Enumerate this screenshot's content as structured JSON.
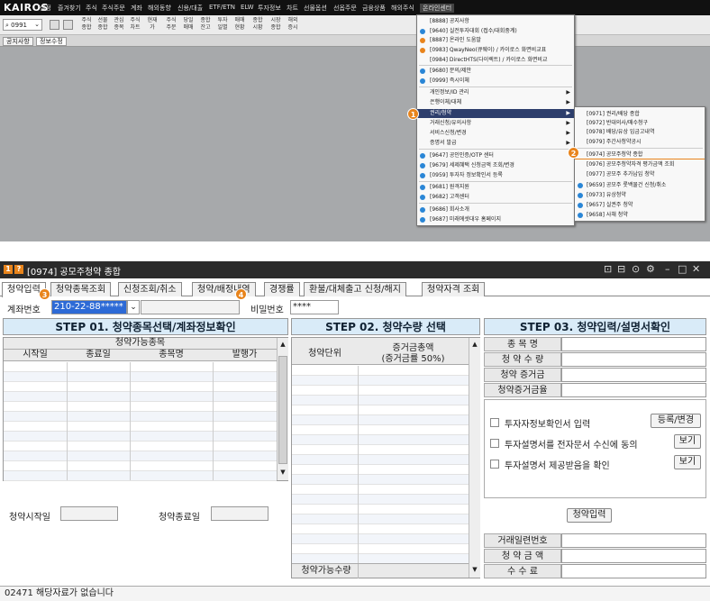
{
  "app": {
    "logo": "KAIROS",
    "menu": [
      "설정",
      "즐겨찾기",
      "주식",
      "주식주문",
      "계좌",
      "해외동향",
      "신용/대출",
      "ETF/ETN",
      "ELW",
      "투자정보",
      "차트",
      "선물옵션",
      "선옵주문",
      "금융상품",
      "해외주식",
      "온라인센터"
    ],
    "code_value": "0991",
    "toolbar_buttons": [
      "주식\n종합",
      "선물\n종합",
      "관심\n종목",
      "주식\n차트",
      "현재\n가",
      "주식\n주문",
      "당일\n매매",
      "종합\n잔고",
      "투자\n일별",
      "매매\n현황",
      "종합\n시황",
      "시장\n종합",
      "해외\n증시"
    ],
    "tabs": [
      "공지사항",
      "정보수정"
    ]
  },
  "dropdown": {
    "items": [
      {
        "label": "[8888] 공지사항",
        "icon": ""
      },
      {
        "label": "[9640] 실전투자대회 (접수/대회중계)",
        "icon": "blue"
      },
      {
        "label": "[8887] 온라인 도움말",
        "icon": "orange"
      },
      {
        "label": "[0983] QwayNeo(큐웨이) / 카이로스 화면비교표",
        "icon": "orange"
      },
      {
        "label": "[0984] DirectHTS(다이렉트) / 카이로스 화면비교",
        "icon": ""
      },
      {
        "label": "[9680] 문의/제안",
        "icon": "blue"
      },
      {
        "label": "[0999] 즉시이체",
        "icon": "blue"
      },
      {
        "label": "개인정보/ID 관리",
        "icon": "",
        "arrow": true
      },
      {
        "label": "은행이체/대체",
        "icon": "",
        "arrow": true
      },
      {
        "label": "권리/청약",
        "icon": "",
        "arrow": true,
        "hl": true
      },
      {
        "label": "거래신청/유의사항",
        "icon": "",
        "arrow": true
      },
      {
        "label": "서비스신청/변경",
        "icon": "",
        "arrow": true
      },
      {
        "label": "증명서 발급",
        "icon": "",
        "arrow": true
      },
      {
        "label": "[9647] 공인인증/OTP 센터",
        "icon": "blue"
      },
      {
        "label": "[9679] 세제혜택 신청금액 조회/변경",
        "icon": "blue"
      },
      {
        "label": "[0959] 투자자 정보확인서 등록",
        "icon": "blue"
      },
      {
        "label": "[9681] 원격지원",
        "icon": "blue"
      },
      {
        "label": "[9682] 고객센터",
        "icon": "blue"
      },
      {
        "label": "[9686] 회사소개",
        "icon": "blue"
      },
      {
        "label": "[9687] 미래에셋대우 홈페이지",
        "icon": "blue"
      }
    ],
    "submenu": [
      {
        "label": "[0971] 권리/배당 종합",
        "icon": ""
      },
      {
        "label": "[0972] 반대의사/매수청구",
        "icon": ""
      },
      {
        "label": "[0978] 배당/유상 입금고내역",
        "icon": ""
      },
      {
        "label": "[0979] 주간사청약공시",
        "icon": ""
      },
      {
        "label": "[0974] 공모주청약 종합",
        "icon": ""
      },
      {
        "label": "[0976] 공모주청약자격 평가금액 조회",
        "icon": ""
      },
      {
        "label": "[0977] 공모주 추가납입 청약",
        "icon": ""
      },
      {
        "label": "[9659] 공모주 롯백물건 신청/취소",
        "icon": "blue"
      },
      {
        "label": "[0973] 유상청약",
        "icon": "blue"
      },
      {
        "label": "[9657] 실권주 청약",
        "icon": "blue"
      },
      {
        "label": "[9658] 사채 청약",
        "icon": "blue"
      }
    ],
    "badges": [
      "1",
      "2",
      "3",
      "4"
    ]
  },
  "window": {
    "title": "[0974] 공모주청약 종합",
    "title_icons": [
      "1",
      "?"
    ],
    "controls": [
      "⊡",
      "⊟",
      "⊙",
      "⚙",
      "–",
      "□",
      "✕"
    ],
    "tabs": [
      "청약입력",
      "청약종목조회",
      "신청조회/취소",
      "청약/배정내역",
      "경쟁률",
      "환불/대체출고 신청/해지",
      "청약자격 조회"
    ],
    "account_label": "계좌번호",
    "account_value": "210-22-88*****",
    "password_label": "비밀번호",
    "password_value": "****",
    "step1": {
      "title": "STEP 01. 청약종목선택/계좌정보확인",
      "group_header": "청약가능종목",
      "columns": [
        "시작일",
        "종료일",
        "종목명",
        "발행가"
      ],
      "start_label": "청약시작일",
      "end_label": "청약종료일"
    },
    "step2": {
      "title": "STEP 02. 청약수량 선택",
      "col1": "청약단위",
      "col2a": "증거금총액",
      "col2b": "(증거금률 50%)",
      "footer": "청약가능수량"
    },
    "step3": {
      "title": "STEP 03. 청약입력/설명서확인",
      "fields": [
        "종 목 명",
        "청 약 수 량",
        "청약 증거금",
        "청약증거금율"
      ],
      "checks": [
        {
          "label": "투자자정보확인서 입력",
          "button": "등록/변경"
        },
        {
          "label": "투자설명서를 전자문서 수신에 동의",
          "button": "보기"
        },
        {
          "label": "투자설명서 제공받음을 확인",
          "button": "보기"
        }
      ],
      "submit": "청약입력",
      "bottom_fields": [
        "거래일련번호",
        "청 약 금 액",
        "수 수 료"
      ]
    },
    "status": "02471 해당자료가 없습니다"
  },
  "colors": {
    "accent": "#e8841c",
    "highlight": "#2d3e6c",
    "step_header": "#d9ebf8"
  }
}
